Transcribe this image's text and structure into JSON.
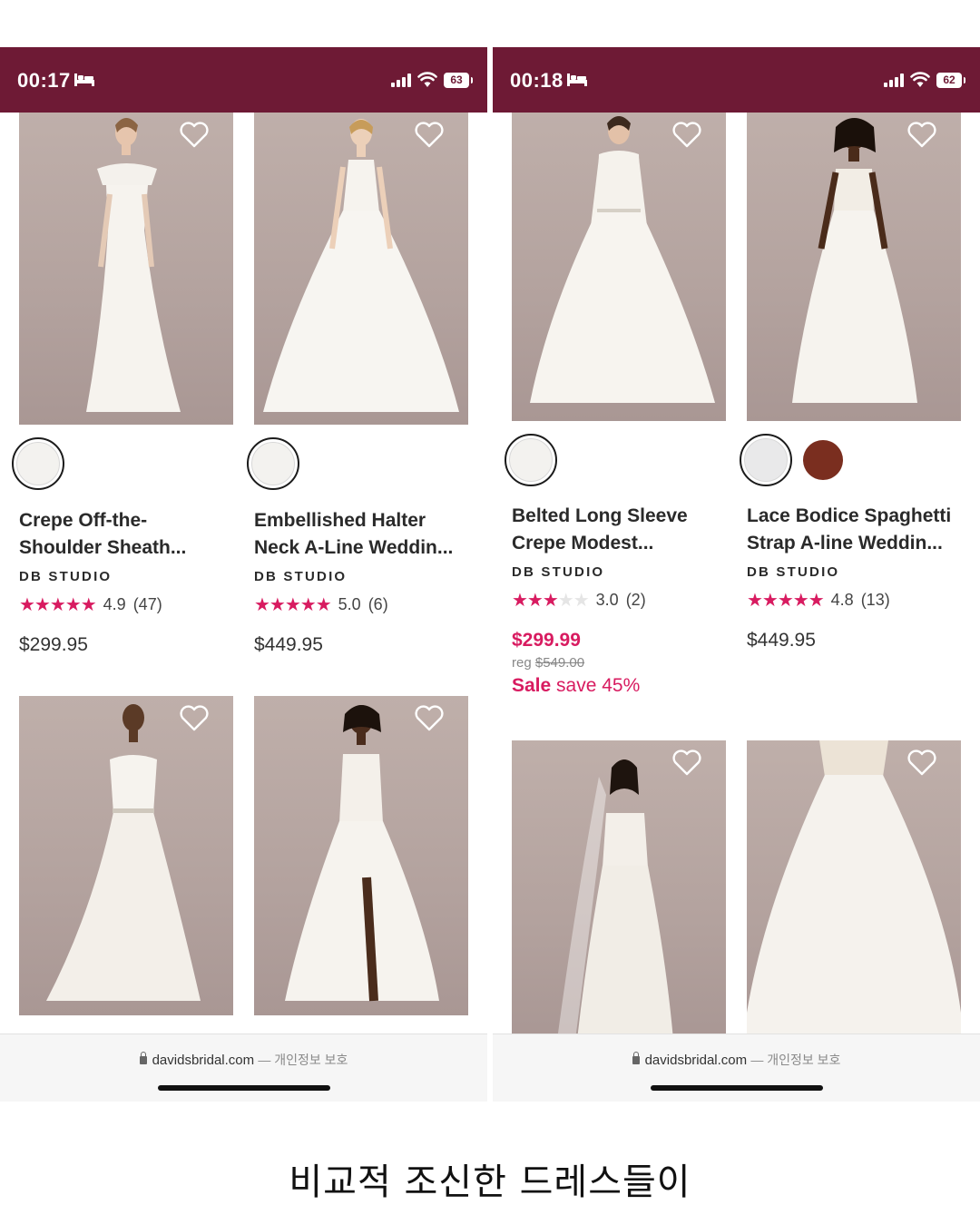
{
  "left_screen": {
    "status": {
      "time": "00:17",
      "battery": "63"
    },
    "products": [
      {
        "name_line1": "Crepe Off-the-",
        "name_line2": "Shoulder Sheath...",
        "brand": "DB STUDIO",
        "stars": 5,
        "rating": "4.9",
        "reviews": "(47)",
        "price": "$299.95",
        "swatches": [
          "#f3f2ef"
        ]
      },
      {
        "name_line1": "Embellished Halter",
        "name_line2": "Neck A-Line Weddin...",
        "brand": "DB STUDIO",
        "stars": 5,
        "rating": "5.0",
        "reviews": "(6)",
        "price": "$449.95",
        "swatches": [
          "#f3f2ef"
        ]
      }
    ],
    "browser": {
      "domain": "davidsbridal.com",
      "suffix": "— 개인정보 보호"
    }
  },
  "right_screen": {
    "status": {
      "time": "00:18",
      "battery": "62"
    },
    "products": [
      {
        "name_line1": "Belted Long Sleeve",
        "name_line2": "Crepe Modest...",
        "brand": "DB STUDIO",
        "stars": 3,
        "rating": "3.0",
        "reviews": "(2)",
        "sale_price": "$299.99",
        "reg_label": "reg",
        "reg_price": "$549.00",
        "sale_word": "Sale",
        "save_text": "save 45%",
        "swatches": [
          "#f3f2ef"
        ]
      },
      {
        "name_line1": "Lace Bodice Spaghetti",
        "name_line2": "Strap A-line Weddin...",
        "brand": "DB STUDIO",
        "stars": 5,
        "rating": "4.8",
        "reviews": "(13)",
        "price": "$449.95",
        "swatches": [
          "#e9e9ea",
          "#7a2e1f"
        ]
      }
    ],
    "browser": {
      "domain": "davidsbridal.com",
      "suffix": "— 개인정보 보호"
    }
  },
  "caption": "비교적 조신한 드레스들이",
  "colors": {
    "status_bar": "#6e1a35",
    "sale": "#d81b60",
    "star": "#d81b60"
  },
  "icons": [
    "bed-icon",
    "signal-icon",
    "wifi-icon",
    "battery-icon",
    "heart-icon",
    "lock-icon"
  ]
}
